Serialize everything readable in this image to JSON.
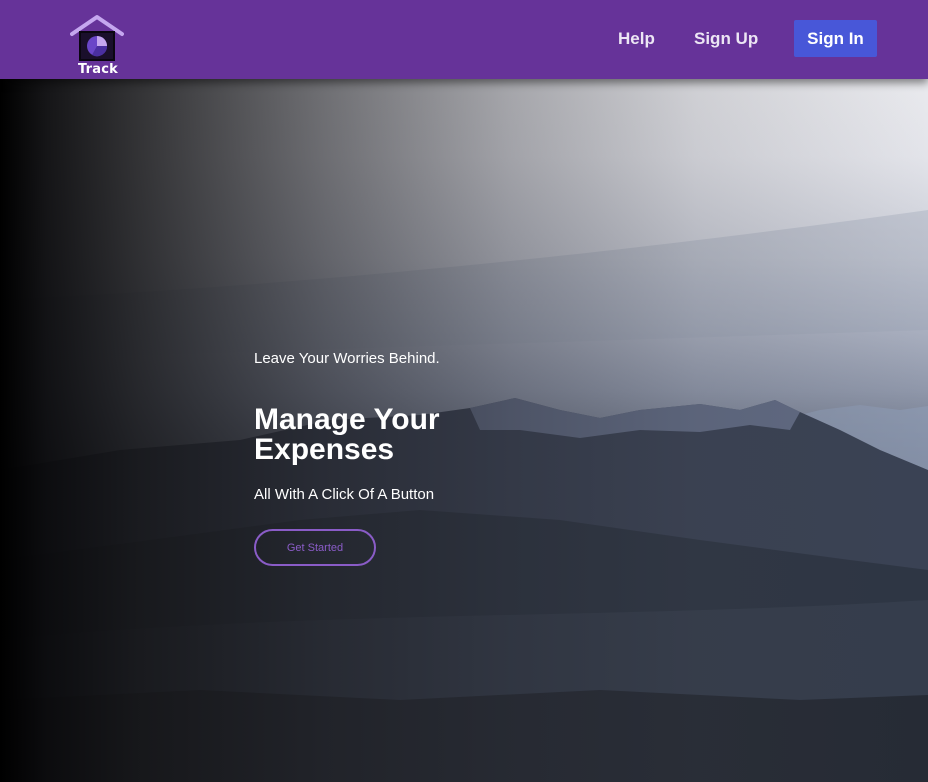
{
  "header": {
    "logo_text": "Track",
    "nav": {
      "help": "Help",
      "sign_up": "Sign Up",
      "sign_in": "Sign In"
    }
  },
  "hero": {
    "tagline": "Leave Your Worries Behind.",
    "headline": "Manage Your Expenses",
    "subline": "All With A Click Of A Button",
    "cta": "Get Started"
  },
  "colors": {
    "header_bg": "#663399",
    "sign_in_bg": "#4857d8",
    "cta_accent": "#8a5cc7"
  },
  "icons": {
    "logo": "house-logo-icon"
  }
}
